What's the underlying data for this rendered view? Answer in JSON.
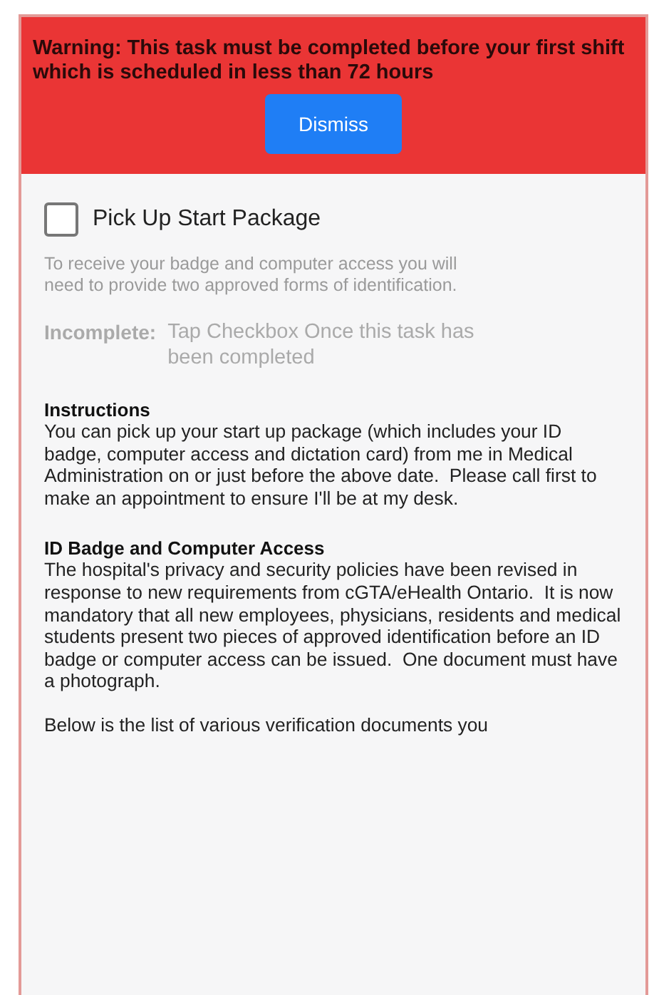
{
  "warning": {
    "text": "Warning: This task must be completed before your first shift which is scheduled in less than 72 hours",
    "button": "Dismiss"
  },
  "task": {
    "title": "Pick Up Start Package",
    "checked": false,
    "description": "To receive your badge and computer access you will need to provide two approved forms of identification.",
    "status_label": "Incomplete:",
    "status_hint": "Tap Checkbox Once this task has been completed"
  },
  "sections": [
    {
      "heading": "Instructions",
      "paragraphs": [
        "You can pick up your start up package (which includes your ID badge, computer access and dictation card) from me in Medical Administration on or just before the above date.  Please call first to make an appointment to ensure I'll be at my desk."
      ]
    },
    {
      "heading": "ID Badge and Computer Access",
      "paragraphs": [
        "The hospital's privacy and security policies have been revised in response to new requirements from cGTA/eHealth Ontario.  It is now mandatory that all new employees, physicians, residents and medical students present two pieces of approved identification before an ID badge or computer access can be issued.  One document must have a photograph.",
        "Below is the list of various verification documents you"
      ]
    }
  ]
}
